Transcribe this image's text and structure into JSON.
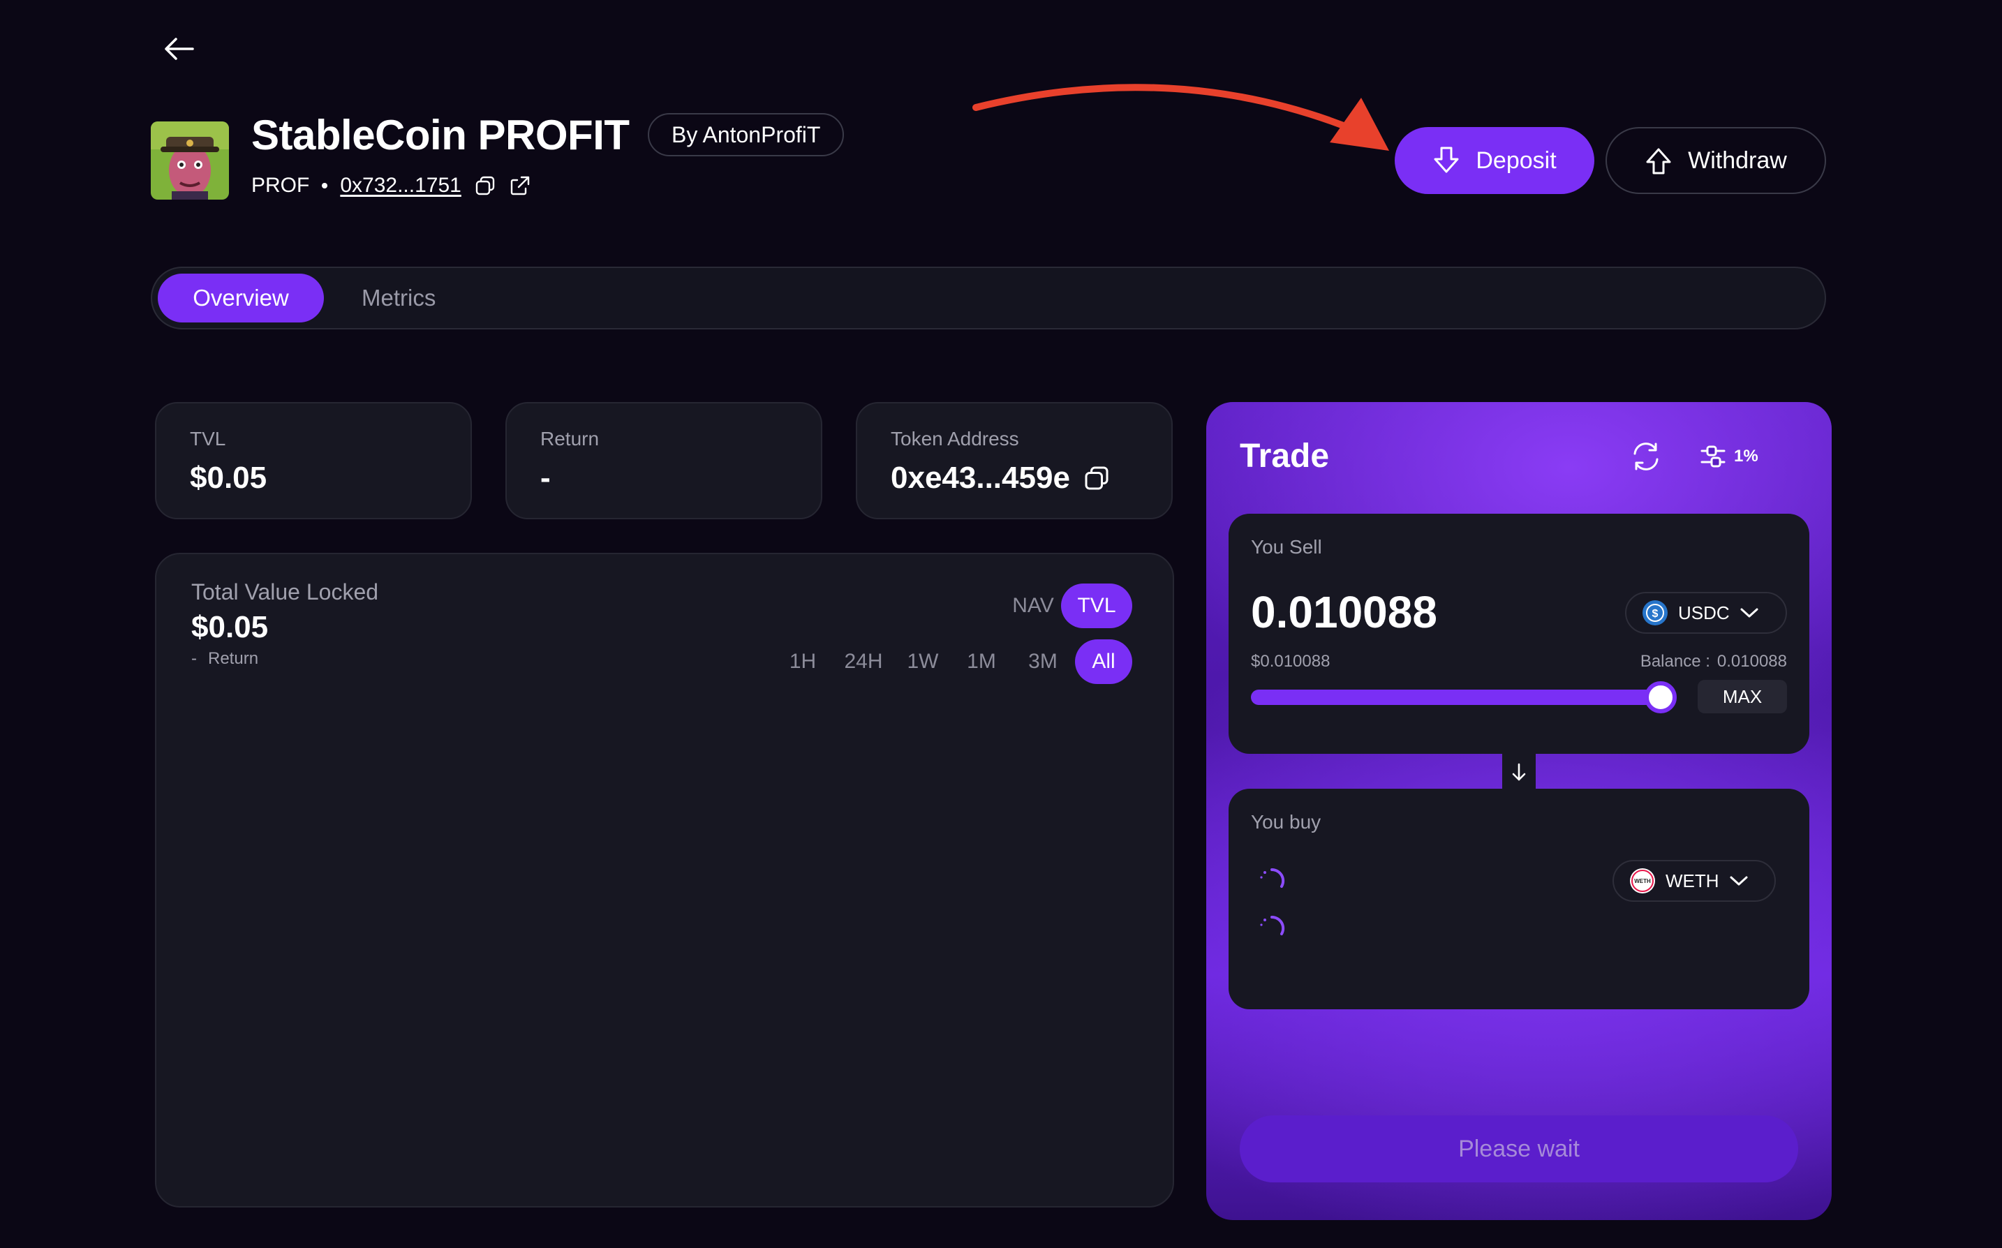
{
  "header": {
    "back_icon": "arrow-left-icon",
    "title": "StableCoin PROFIT",
    "by_label": "By AntonProfiT",
    "symbol": "PROF",
    "address": "0x732...1751",
    "copy_icon": "copy-icon",
    "external_icon": "external-link-icon",
    "deposit_label": "Deposit",
    "withdraw_label": "Withdraw"
  },
  "tabs": [
    {
      "label": "Overview",
      "active": true
    },
    {
      "label": "Metrics",
      "active": false
    }
  ],
  "stats": {
    "tvl_label": "TVL",
    "tvl_value": "$0.05",
    "return_label": "Return",
    "return_value": "-",
    "token_label": "Token Address",
    "token_value": "0xe43...459e"
  },
  "chart": {
    "title": "Total Value Locked",
    "value": "$0.05",
    "return_dash": "-",
    "return_label": "Return",
    "modes": [
      "NAV",
      "TVL"
    ],
    "active_mode": "TVL",
    "ranges": [
      "1H",
      "24H",
      "1W",
      "1M",
      "3M",
      "All"
    ],
    "active_range": "All"
  },
  "trade": {
    "title": "Trade",
    "slippage": "1%",
    "sell_label": "You Sell",
    "sell_amount": "0.010088",
    "sell_usd": "$0.010088",
    "balance_label": "Balance :",
    "balance_value": "0.010088",
    "sell_token": "USDC",
    "max_label": "MAX",
    "slider_fraction": 1.0,
    "buy_label": "You buy",
    "buy_token": "WETH",
    "weth_badge": "WETH",
    "usdc_icon": "usdc-icon",
    "button_label": "Please wait"
  },
  "colors": {
    "accent": "#7a2ff5",
    "background": "#0b0715",
    "card": "#171722",
    "annotation_arrow": "#e8412c"
  }
}
